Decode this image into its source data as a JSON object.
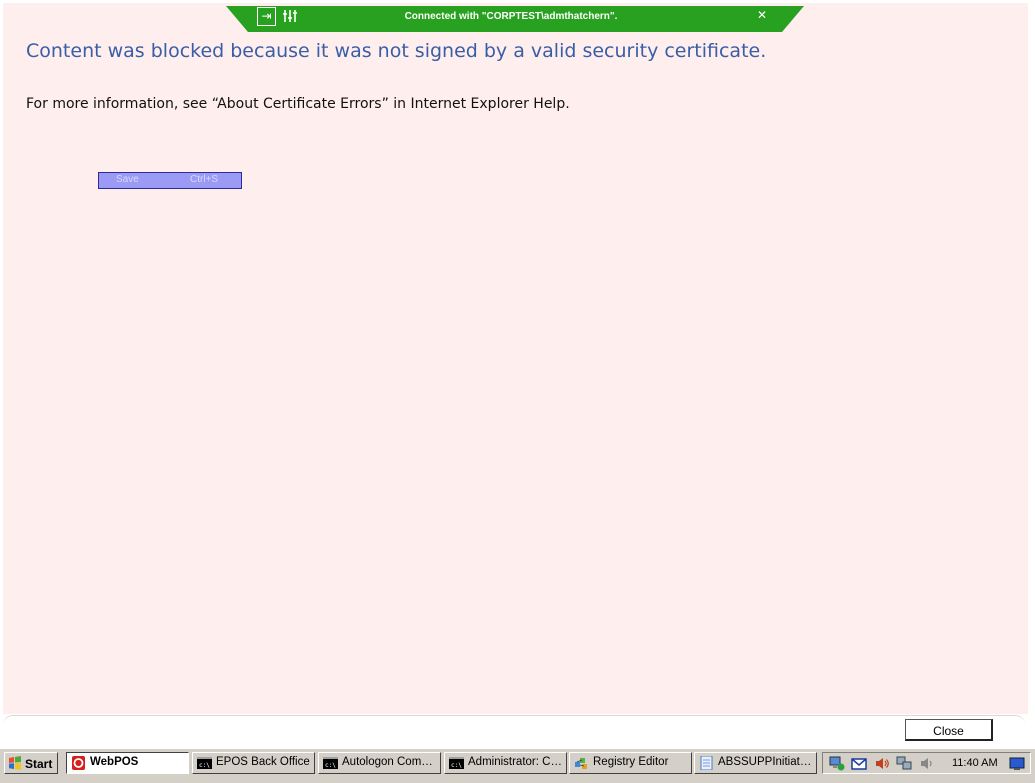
{
  "connection_bar": {
    "text": "Connected with \"CORPTEST\\admthatchern\".",
    "pin_icon": "pin-icon",
    "tools_icon": "tools-icon",
    "close_icon": "close-icon",
    "color": "#28a020"
  },
  "content": {
    "heading": "Content was blocked because it was not signed by a valid security certificate.",
    "info": "For more information, see “About Certificate Errors” in Internet Explorer Help.",
    "background": "#ffeeee",
    "heading_color": "#3a5ea5"
  },
  "context_menu": {
    "item_label": "Save",
    "item_shortcut": "Ctrl+S"
  },
  "footer": {
    "close_label": "Close"
  },
  "taskbar": {
    "start_label": "Start",
    "buttons": [
      {
        "label": "WebPOS",
        "icon": "webpos-icon",
        "active": true
      },
      {
        "label": "EPOS Back Office",
        "icon": "console-icon",
        "active": false
      },
      {
        "label": "Autologon Comm...",
        "icon": "console-icon",
        "active": false
      },
      {
        "label": "Administrator: C:...",
        "icon": "console-icon",
        "active": false
      },
      {
        "label": "Registry Editor",
        "icon": "registry-editor-icon",
        "active": false
      },
      {
        "label": "ABSSUPPInitiate...",
        "icon": "notepad-icon",
        "active": false
      }
    ],
    "tray_icons": [
      "network-media-icon",
      "mail-icon",
      "volume-icon",
      "network-icon",
      "speaker-icon"
    ],
    "clock": "11:40 AM"
  }
}
